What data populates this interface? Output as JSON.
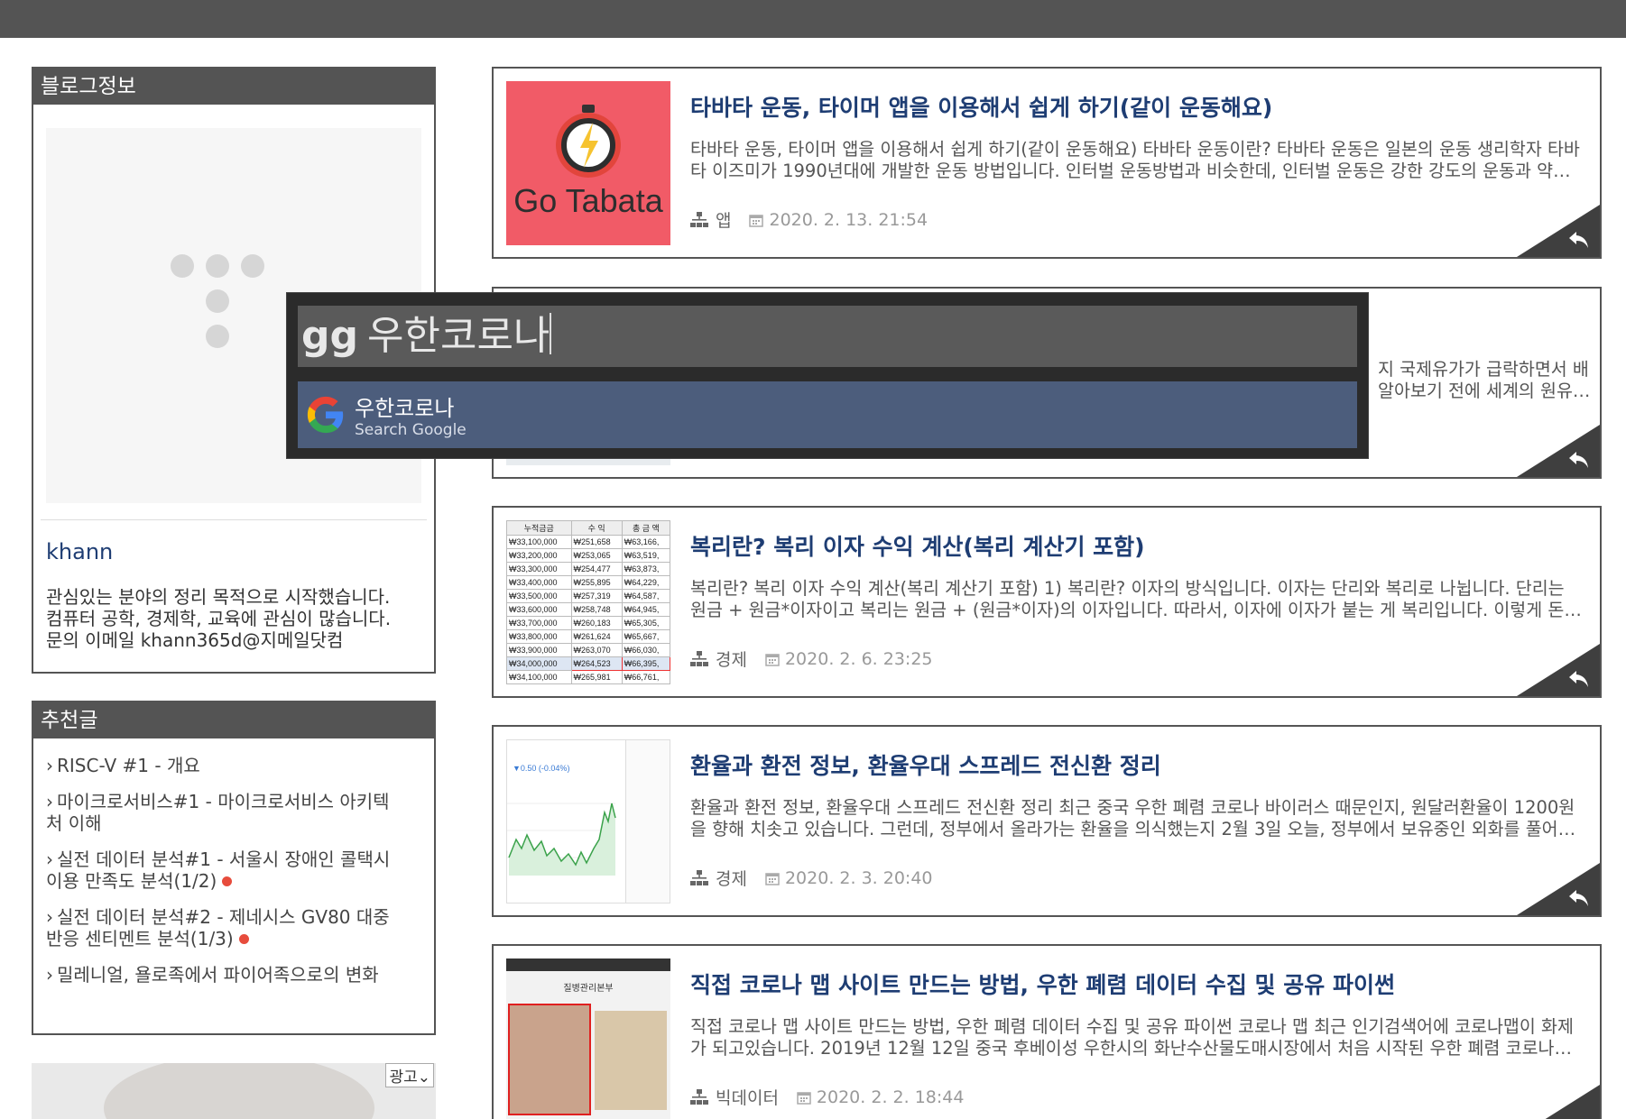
{
  "sidebar": {
    "blog_info": {
      "title": "블로그정보",
      "name": "khann",
      "description_lines": [
        "관심있는 분야의 정리 목적으로 시작했습니다.",
        "컴퓨터 공학, 경제학, 교육에 관심이 많습니다.",
        "문의 이메일 khann365d@지메일닷컴"
      ]
    },
    "recommended": {
      "title": "추천글",
      "items": [
        {
          "lines": [
            "RISC-V #1 - 개요"
          ],
          "new": false
        },
        {
          "lines": [
            "마이크로서비스#1 - 마이크로서비스 아키텍",
            "처 이해"
          ],
          "new": false
        },
        {
          "lines": [
            "실전 데이터 분석#1 - 서울시 장애인 콜택시",
            "이용 만족도 분석(1/2)"
          ],
          "new": true
        },
        {
          "lines": [
            "실전 데이터 분석#2 - 제네시스 GV80 대중",
            "반응 센티멘트 분석(1/3)"
          ],
          "new": true
        },
        {
          "lines": [
            "밀레니얼, 욜로족에서 파이어족으로의 변화"
          ],
          "new": false
        }
      ]
    },
    "ad_label": "광고"
  },
  "posts": [
    {
      "title": "타바타 운동, 타이머 앱을 이용해서 쉽게 하기(같이 운동해요)",
      "summary": [
        "타바타 운동, 타이머 앱을 이용해서 쉽게 하기(같이 운동해요) 타바타 운동이란? 타바타 운동은 일본의 운동 생리학자 타바",
        "타 이즈미가 1990년대에 개발한 운동 방법입니다. 인터벌 운동방법과 비슷한데, 인터벌 운동은 강한 강도의 운동과 약…"
      ],
      "category": "앱",
      "date": "2020. 2. 13. 21:54",
      "thumb_text": "Go Tabata"
    },
    {
      "title": "",
      "summary": [
        "지 국제유가가 급락하면서 배",
        "알아보기 전에 세계의 원유…"
      ],
      "category": "",
      "date": ""
    },
    {
      "title": "복리란? 복리 이자 수익 계산(복리 계산기 포함)",
      "summary": [
        "복리란? 복리 이자 수익 계산(복리 계산기 포함) 1) 복리란? 이자의 방식입니다. 이자는 단리와 복리로 나뉩니다. 단리는",
        "원금 + 원금*이자이고 복리는 원금 + (원금*이자)의 이자입니다. 따라서, 이자에 이자가 붙는 게 복리입니다. 이렇게 돈…"
      ],
      "category": "경제",
      "date": "2020. 2. 6. 23:25",
      "thumb_table": {
        "headers": [
          "누적금금",
          "수 익",
          "총 금 액"
        ],
        "rows": [
          [
            "₩33,100,000",
            "₩251,658",
            "₩63,166,"
          ],
          [
            "₩33,200,000",
            "₩253,065",
            "₩63,519,"
          ],
          [
            "₩33,300,000",
            "₩254,477",
            "₩63,873,"
          ],
          [
            "₩33,400,000",
            "₩255,895",
            "₩64,229,"
          ],
          [
            "₩33,500,000",
            "₩257,319",
            "₩64,587,"
          ],
          [
            "₩33,600,000",
            "₩258,748",
            "₩64,945,"
          ],
          [
            "₩33,700,000",
            "₩260,183",
            "₩65,305,"
          ],
          [
            "₩33,800,000",
            "₩261,624",
            "₩65,667,"
          ],
          [
            "₩33,900,000",
            "₩263,070",
            "₩66,030,"
          ],
          [
            "₩34,000,000",
            "₩264,523",
            "₩66,395,"
          ],
          [
            "₩34,100,000",
            "₩265,981",
            "₩66,761,"
          ]
        ]
      }
    },
    {
      "title": "환율과 환전 정보, 환율우대 스프레드 전신환 정리",
      "summary": [
        "환율과 환전 정보, 환율우대 스프레드 전신환 정리 최근 중국 우한 폐렴 코로나 바이러스 때문인지, 원달러환율이 1200원",
        "을 향해 치솟고 있습니다. 그런데, 정부에서 올라가는 환율을 의식했는지 2월 3일 오늘, 정부에서 보유중인 외화를 풀어…"
      ],
      "category": "경제",
      "date": "2020. 2. 3. 20:40",
      "thumb_change": "▼0.50 (-0.04%)"
    },
    {
      "title": "직접 코로나 맵 사이트 만드는 방법, 우한 폐렴 데이터 수집 및 공유 파이썬",
      "summary": [
        "직접 코로나 맵 사이트 만드는 방법, 우한 폐렴 데이터 수집 및 공유 파이썬 코로나 맵 최근 인기검색어에 코로나맵이 화제",
        "가 되고있습니다. 2019년 12월 12일 중국 후베이성 우한시의 화난수산물도매시장에서 처음 시작된 우한 폐렴 코로나…"
      ],
      "category": "빅데이터",
      "date": "2020. 2. 2. 18:44",
      "thumb_header": "질병관리본부"
    }
  ],
  "launcher": {
    "prefix": "gg",
    "query": "우한코로나",
    "result_title": "우한코로나",
    "result_subtitle": "Search Google"
  },
  "colors": {
    "topbar": "#545454",
    "title_blue": "#1e3d73",
    "launcher_bg": "#2b2b2b",
    "launcher_selected": "#4c5d7c",
    "tabata_bg": "#f15b67"
  }
}
